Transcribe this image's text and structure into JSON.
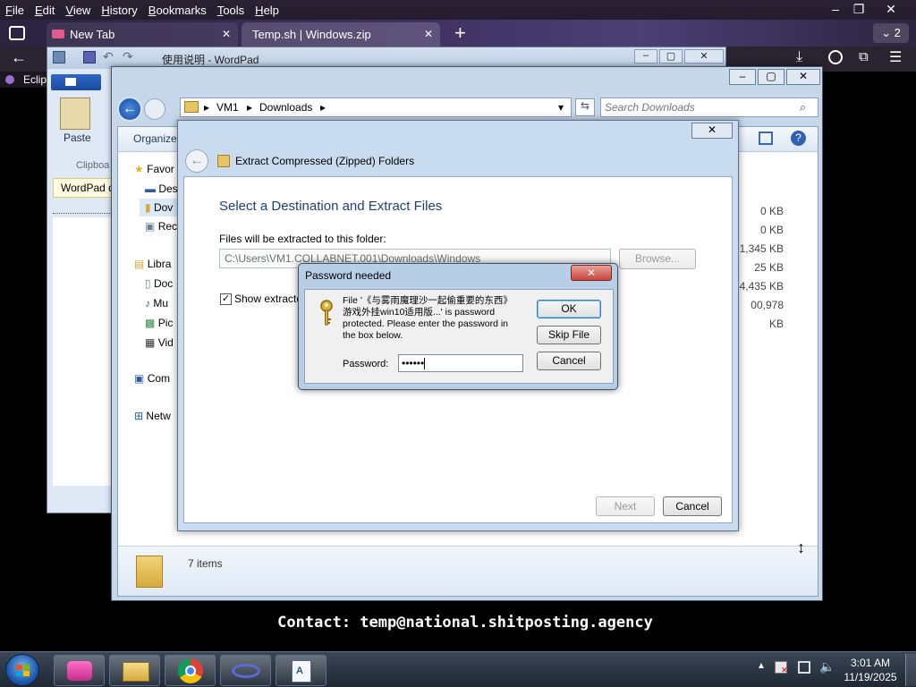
{
  "firefox": {
    "menu": [
      "File",
      "Edit",
      "View",
      "History",
      "Bookmarks",
      "Tools",
      "Help"
    ],
    "window_controls": [
      "–",
      "❐",
      "✕"
    ],
    "tabs": [
      {
        "label": "New Tab",
        "close": "✕"
      },
      {
        "label": "Temp.sh | Windows.zip",
        "close": "✕"
      }
    ],
    "new_tab": "+",
    "tab_count": "2",
    "bookmark_label": "Eclip"
  },
  "wordpad": {
    "title": "使用说明 - WordPad",
    "paste_label": "Paste",
    "clipboard_label": "Clipboa",
    "status_label": "WordPad d"
  },
  "explorer": {
    "breadcrumb": [
      "VM1",
      "Downloads"
    ],
    "search_placeholder": "Search Downloads",
    "organize": "Organize",
    "sidebar": [
      {
        "label": "Favor",
        "icon": "star-icon"
      },
      {
        "label": "Des",
        "icon": "desktop-icon"
      },
      {
        "label": "Dov",
        "icon": "folder-icon"
      },
      {
        "label": "Rec",
        "icon": "recent-icon"
      },
      {
        "label": "Libra",
        "icon": "library-icon"
      },
      {
        "label": "Doc",
        "icon": "document-icon"
      },
      {
        "label": "Mu",
        "icon": "music-icon"
      },
      {
        "label": "Pic",
        "icon": "picture-icon"
      },
      {
        "label": "Vid",
        "icon": "video-icon"
      },
      {
        "label": "Com",
        "icon": "computer-icon"
      },
      {
        "label": "Netw",
        "icon": "network-icon"
      }
    ],
    "sizes": [
      "0 KB",
      "0 KB",
      "1,345 KB",
      "25 KB",
      "4,435 KB",
      "00,978 KB"
    ],
    "status": "7 items"
  },
  "extract": {
    "title": "Extract Compressed (Zipped) Folders",
    "heading": "Select a Destination and Extract Files",
    "folder_label": "Files will be extracted to this folder:",
    "folder_path": "C:\\Users\\VM1.COLLABNET.001\\Downloads\\Windows",
    "browse": "Browse...",
    "show_checkbox": "Show extracte",
    "next": "Next",
    "cancel": "Cancel"
  },
  "password_dialog": {
    "title": "Password needed",
    "message_line1": "File '《与雾雨魔理沙一起偷重要的东西》",
    "message_line2": "游戏外挂win10适用版...' is password",
    "message_line3": "protected.  Please enter the password in",
    "message_line4": "the box below.",
    "password_label": "Password:",
    "password_value": "••••••",
    "ok": "OK",
    "skip": "Skip File",
    "cancel": "Cancel",
    "close": "✕"
  },
  "overlay_text": "Contact: temp@national.shitposting.agency",
  "taskbar": {
    "time": "3:01 AM",
    "date": "11/19/2025"
  },
  "colors": {
    "vista_blue": "#1f4f8f",
    "close_red": "#c9463d",
    "heading_blue": "#1e3f7a"
  }
}
